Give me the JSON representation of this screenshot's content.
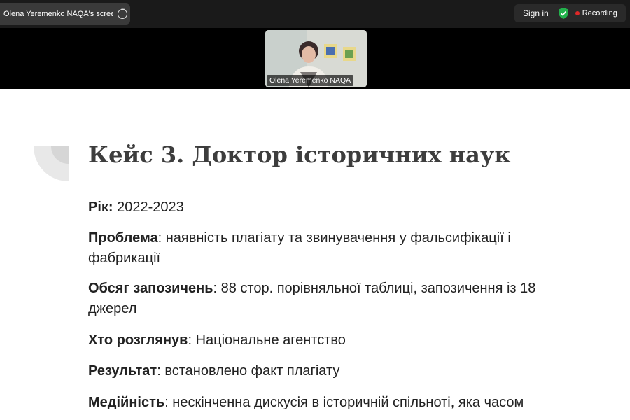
{
  "topbar": {
    "share_title": "Olena Yeremenko NAQA's screen",
    "sign_in": "Sign in",
    "recording": "Recording",
    "colors": {
      "shield": "#22b14c",
      "record_dot": "#e02828"
    }
  },
  "video": {
    "participant_name": "Olena Yeremenko NAQA"
  },
  "slide": {
    "title": "Кейс 3. Доктор історичних наук",
    "items": [
      {
        "label": "Рік:",
        "text": " 2022-2023"
      },
      {
        "label": "Проблема",
        "text": ": наявність плагіату та звинувачення у фальсифікації і фабрикації"
      },
      {
        "label": "Обсяг запозичень",
        "text": ": 88 стор. порівняльної таблиці, запозичення із 18 джерел"
      },
      {
        "label": "Хто розглянув",
        "text": ": Національне агентство"
      },
      {
        "label": "Результат",
        "text": ":  встановлено факт плагіату"
      },
      {
        "label": "Медійність",
        "text": ": нескінченна дискусія в історичній спільноті, яка часом"
      }
    ]
  }
}
